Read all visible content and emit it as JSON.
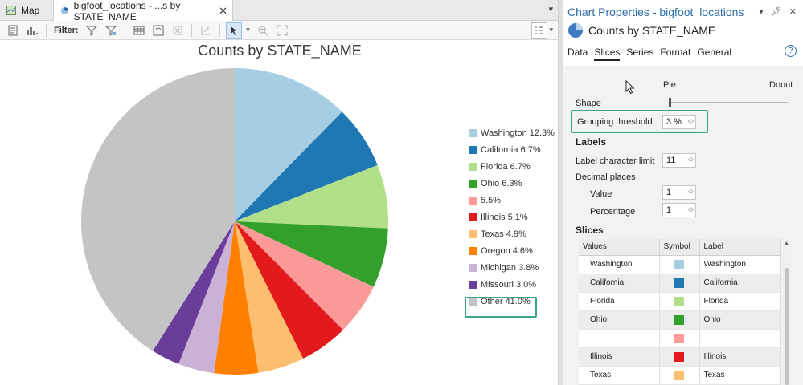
{
  "tabs": {
    "map_label": "Map",
    "chart_label": "bigfoot_locations - ...s by STATE_NAME"
  },
  "toolbar": {
    "filter_label": "Filter:"
  },
  "chart_data": {
    "type": "pie",
    "title": "Counts by STATE_NAME",
    "slices": [
      {
        "label": "Washington",
        "value": 12.3,
        "color": "#a6cee3"
      },
      {
        "label": "California",
        "value": 6.7,
        "color": "#1f78b4"
      },
      {
        "label": "Florida",
        "value": 6.7,
        "color": "#b2df8a"
      },
      {
        "label": "Ohio",
        "value": 6.3,
        "color": "#33a02c"
      },
      {
        "label": "",
        "value": 5.5,
        "color": "#fb9a99"
      },
      {
        "label": "Illinois",
        "value": 5.1,
        "color": "#e31a1c"
      },
      {
        "label": "Texas",
        "value": 4.9,
        "color": "#fdbf6f"
      },
      {
        "label": "Oregon",
        "value": 4.6,
        "color": "#ff7f00"
      },
      {
        "label": "Michigan",
        "value": 3.8,
        "color": "#cab2d6"
      },
      {
        "label": "Missouri",
        "value": 3.0,
        "color": "#6a3d9a"
      },
      {
        "label": "Other",
        "value": 41.0,
        "color": "#c4c4c4"
      }
    ],
    "legend_position": "right",
    "legend_entries": [
      "Washington 12.3%",
      "California 6.7%",
      "Florida 6.7%",
      "Ohio 6.3%",
      "5.5%",
      "Illinois 5.1%",
      "Texas 4.9%",
      "Oregon 4.6%",
      "Michigan 3.8%",
      "Missouri 3.0%",
      "Other 41.0%"
    ]
  },
  "pane": {
    "title": "Chart Properties - bigfoot_locations",
    "chart_name": "Counts by STATE_NAME",
    "tabs": [
      "Data",
      "Slices",
      "Series",
      "Format",
      "General"
    ],
    "active_tab": "Slices",
    "help": "?",
    "shape_label": "Shape",
    "shape_pie": "Pie",
    "shape_donut": "Donut",
    "grouping_label": "Grouping threshold",
    "grouping_value": "3 %",
    "labels_header": "Labels",
    "label_char_limit_label": "Label character limit",
    "label_char_limit_value": "11",
    "decimal_places_label": "Decimal places",
    "value_label": "Value",
    "value_value": "1",
    "percentage_label": "Percentage",
    "percentage_value": "1",
    "slices_header": "Slices",
    "table_headers": [
      "Values",
      "Symbol",
      "Label"
    ],
    "table_rows": [
      {
        "value": "Washington",
        "color": "#a6cee3",
        "label": "Washington"
      },
      {
        "value": "California",
        "color": "#1f78b4",
        "label": "California"
      },
      {
        "value": "Florida",
        "color": "#b2df8a",
        "label": "Florida"
      },
      {
        "value": "Ohio",
        "color": "#33a02c",
        "label": "Ohio"
      },
      {
        "value": "",
        "color": "#fb9a99",
        "label": ""
      },
      {
        "value": "Illinois",
        "color": "#e31a1c",
        "label": "Illinois"
      },
      {
        "value": "Texas",
        "color": "#fdbf6f",
        "label": "Texas"
      }
    ]
  }
}
